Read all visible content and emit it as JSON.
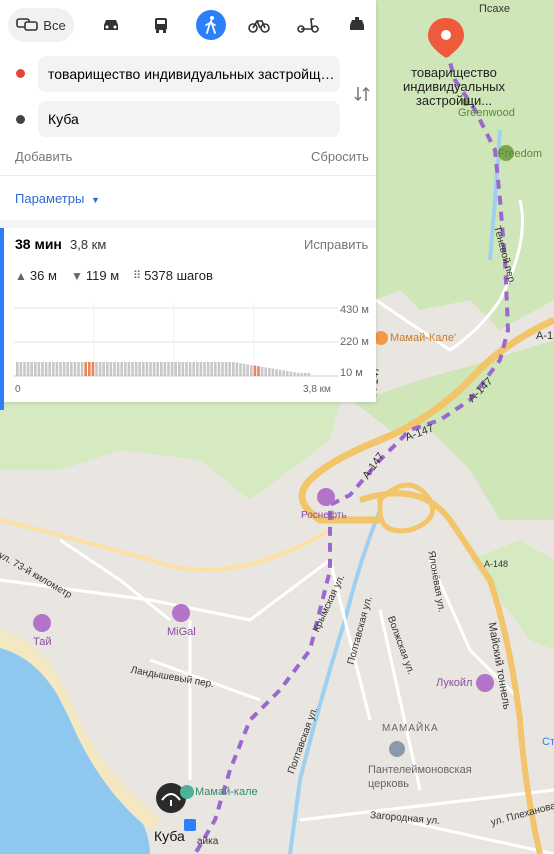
{
  "colors": {
    "accent": "#2d7ff9",
    "route_dashed": "#9a68d0",
    "destination_pin": "#f05a3c",
    "origin_dot": "#e2453c",
    "forest": "#cfe6b8",
    "water": "#8ec8ee",
    "highway": "#f2c56b",
    "elevation_bar": "#c8c8c8",
    "elevation_highlight": "#e8855a"
  },
  "modes": {
    "all_label": "Все",
    "icons": [
      "car-directions-icon",
      "car-icon",
      "bus-icon",
      "walk-icon",
      "bicycle-icon",
      "scooter-icon",
      "taxi-icon"
    ],
    "active": "walk-icon"
  },
  "route_form": {
    "from": "товарищество индивидуальных застройщиков",
    "to": "Куба",
    "add_label": "Добавить",
    "reset_label": "Сбросить",
    "params_label": "Параметры"
  },
  "route": {
    "time": "38 мин",
    "distance": "3,8 км",
    "edit_label": "Исправить",
    "ascent": "36 м",
    "descent": "119 м",
    "steps": "5378 шагов",
    "elevation_ticks": [
      "430 м",
      "220 м",
      "10 м"
    ],
    "x_start": "0",
    "x_end": "3,8 км"
  },
  "map": {
    "destination_label": "товарищество индивидуальных застройщи...",
    "start_label": "Куба",
    "labels": {
      "psakhe": "Псахе",
      "greenwood": "Greenwood",
      "freedom": "Freedom",
      "teneviy": "Теневой пер.",
      "mamay_kale_top": "Мамай-Кале'",
      "a147a": "А-147",
      "a147b": "А-147",
      "a147c": "А-147",
      "a147d": "А-147",
      "a147e": "А-1",
      "rosneft": "Роснефть",
      "a148": "А-148",
      "km73": "ул. 73-й километр",
      "krymskaya": "Крымская ул.",
      "poltavskaya": "Полтавская ул.",
      "poltavskaya_lower": "Полтавская ул.",
      "volzhskaya": "Волжская ул.",
      "yalonevaya": "Ялонёвая ул.",
      "tunnel": "Майский тоннель",
      "migal": "MiGal",
      "tay": "Тай",
      "lanshevy": "Ландышевый пер.",
      "lukoil": "Лукойл",
      "mamayka": "МАМАЙКА",
      "church": "Пантелеймоновская церковь",
      "mamay_kale_bottom": "Мамай-кале",
      "zagorodnaya": "Загородная ул.",
      "plekhanova": "ул. Плеханова",
      "mamayka_stop": "айка",
      "st": "Ст"
    }
  }
}
